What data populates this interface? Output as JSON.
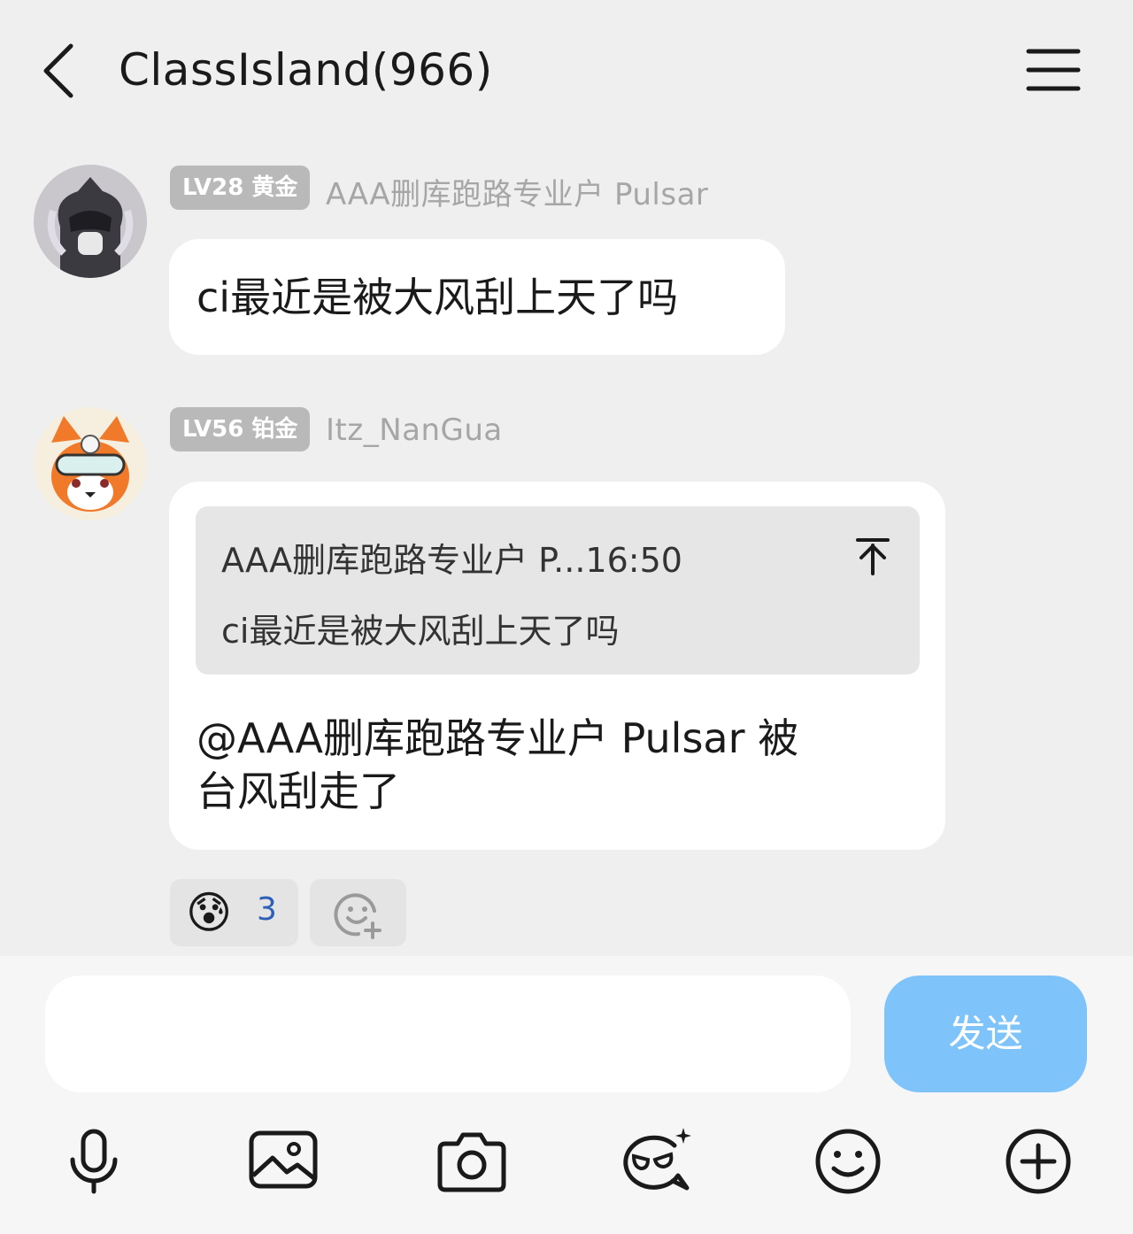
{
  "header": {
    "title": "ClassIsland(966)",
    "back_icon": "back-arrow-icon",
    "menu_icon": "hamburger-menu-icon"
  },
  "messages": [
    {
      "badge": "LV28 黄金",
      "nickname": "AAA删库跑路专业户 Pulsar",
      "text": "ci最近是被大风刮上天了吗"
    },
    {
      "badge": "LV56 铂金",
      "nickname": "Itz_NanGua",
      "quote": {
        "name": "AAA删库跑路专业户 P...16:50",
        "text": "ci最近是被大风刮上天了吗"
      },
      "text_line1": "@AAA删库跑路专业户 Pulsar 被",
      "text_line2": "台风刮走了",
      "reaction": {
        "emoji": "😰",
        "count": "3"
      }
    }
  ],
  "composer": {
    "input_value": "",
    "send_label": "发送",
    "send_color": "#7ec4fb"
  },
  "toolbar": [
    "microphone-icon",
    "image-icon",
    "camera-icon",
    "sticker-icon",
    "emoji-icon",
    "plus-icon"
  ]
}
